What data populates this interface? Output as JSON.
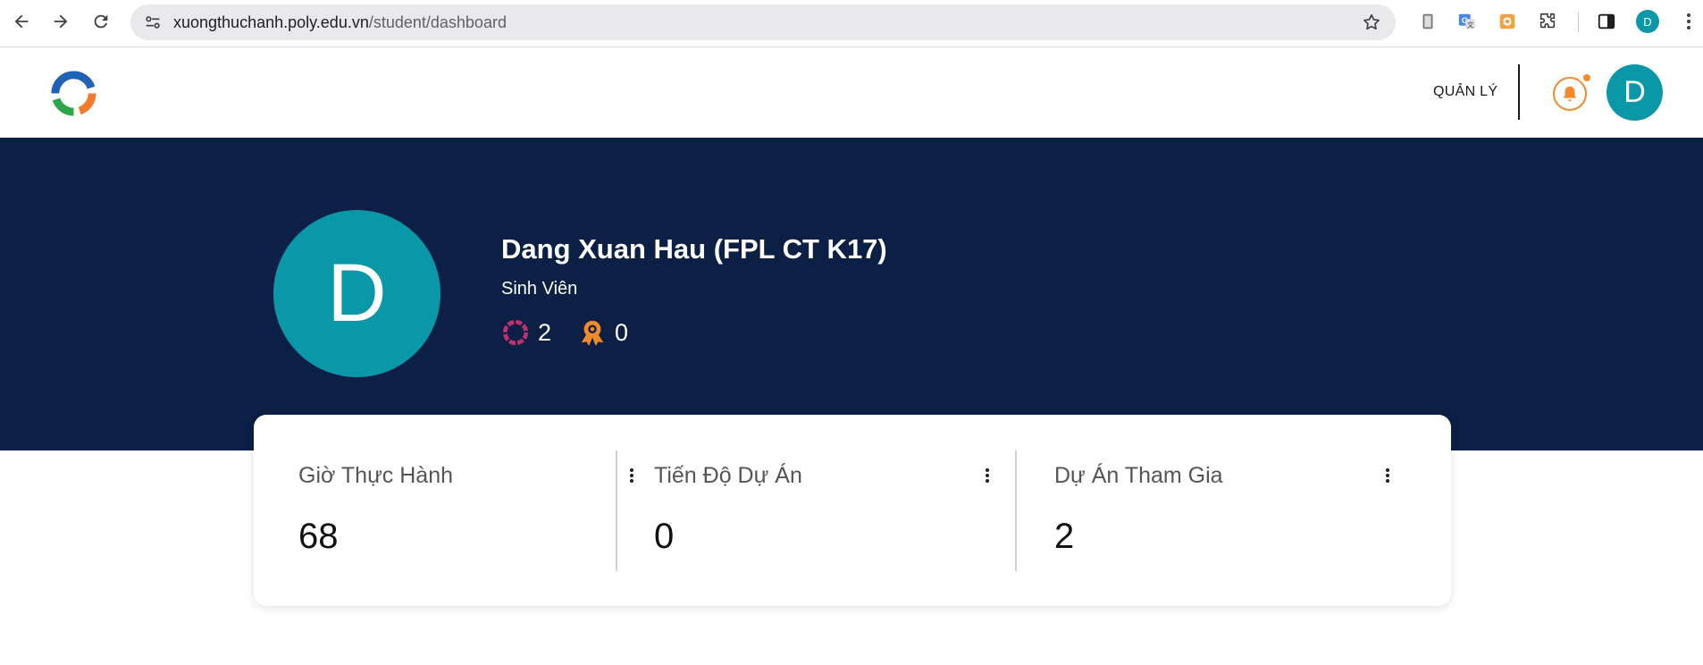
{
  "browser": {
    "url_host": "xuongthuchanh.poly.edu.vn",
    "url_path": "/student/dashboard",
    "profile_initial": "D"
  },
  "header": {
    "manage_label": "QUẢN LÝ",
    "avatar_initial": "D",
    "accent_color": "#f08a2c",
    "avatar_color": "#0a97a8"
  },
  "profile": {
    "avatar_initial": "D",
    "name": "Dang Xuan Hau (FPL CT K17)",
    "role": "Sinh Viên",
    "projects_count": "2",
    "awards_count": "0",
    "hero_color": "#0c1f44"
  },
  "stats": [
    {
      "label": "Giờ Thực Hành",
      "value": "68"
    },
    {
      "label": "Tiến Độ Dự Án",
      "value": "0"
    },
    {
      "label": "Dự Án Tham Gia",
      "value": "2"
    }
  ]
}
